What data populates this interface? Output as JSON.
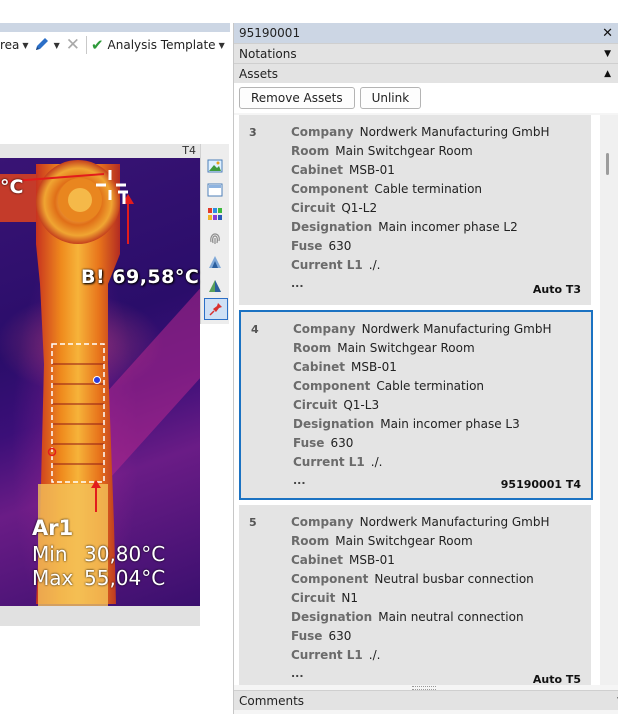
{
  "toolbar": {
    "area_label": "rea",
    "analysis_template_label": "Analysis Template"
  },
  "thermal": {
    "tag": "T4",
    "spot_left_label": "°C",
    "spot_b_label": "B! 69,58°C",
    "area_title": "Ar1",
    "min_label": "Min",
    "min_value": "30,80°C",
    "max_label": "Max",
    "max_value": "55,04°C"
  },
  "side_tools": [
    "image-icon",
    "window-icon",
    "palette-icon",
    "fingerprint-icon",
    "stack-icon",
    "analysis-icon",
    "pin-icon"
  ],
  "panel": {
    "title": "95190001",
    "sections": {
      "notations": "Notations",
      "assets": "Assets",
      "comments": "Comments"
    },
    "buttons": {
      "remove_assets": "Remove Assets",
      "unlink": "Unlink"
    }
  },
  "assets": [
    {
      "num": "3",
      "fields": [
        {
          "k": "Company",
          "v": "Nordwerk Manufacturing GmbH"
        },
        {
          "k": "Room",
          "v": "Main Switchgear Room"
        },
        {
          "k": "Cabinet",
          "v": "MSB-01"
        },
        {
          "k": "Component",
          "v": "Cable termination"
        },
        {
          "k": "Circuit",
          "v": "Q1-L2"
        },
        {
          "k": "Designation",
          "v": "Main incomer phase L2"
        },
        {
          "k": "Fuse",
          "v": "630"
        },
        {
          "k": "Current L1",
          "v": "./."
        }
      ],
      "more": "...",
      "foot": "Auto T3",
      "selected": false
    },
    {
      "num": "4",
      "fields": [
        {
          "k": "Company",
          "v": "Nordwerk Manufacturing GmbH"
        },
        {
          "k": "Room",
          "v": "Main Switchgear Room"
        },
        {
          "k": "Cabinet",
          "v": "MSB-01"
        },
        {
          "k": "Component",
          "v": "Cable termination"
        },
        {
          "k": "Circuit",
          "v": "Q1-L3"
        },
        {
          "k": "Designation",
          "v": "Main incomer phase L3"
        },
        {
          "k": "Fuse",
          "v": "630"
        },
        {
          "k": "Current L1",
          "v": "./."
        }
      ],
      "more": "...",
      "foot": "95190001 T4",
      "selected": true
    },
    {
      "num": "5",
      "fields": [
        {
          "k": "Company",
          "v": "Nordwerk Manufacturing GmbH"
        },
        {
          "k": "Room",
          "v": "Main Switchgear Room"
        },
        {
          "k": "Cabinet",
          "v": "MSB-01"
        },
        {
          "k": "Component",
          "v": "Neutral busbar connection"
        },
        {
          "k": "Circuit",
          "v": "N1"
        },
        {
          "k": "Designation",
          "v": "Main neutral connection"
        },
        {
          "k": "Fuse",
          "v": "630"
        },
        {
          "k": "Current L1",
          "v": "./."
        }
      ],
      "more": "...",
      "foot": "Auto T5",
      "selected": false
    }
  ],
  "colors": {
    "selection": "#1b72c2",
    "title_bar": "#ccd6e4",
    "check": "#2e9a3a"
  }
}
